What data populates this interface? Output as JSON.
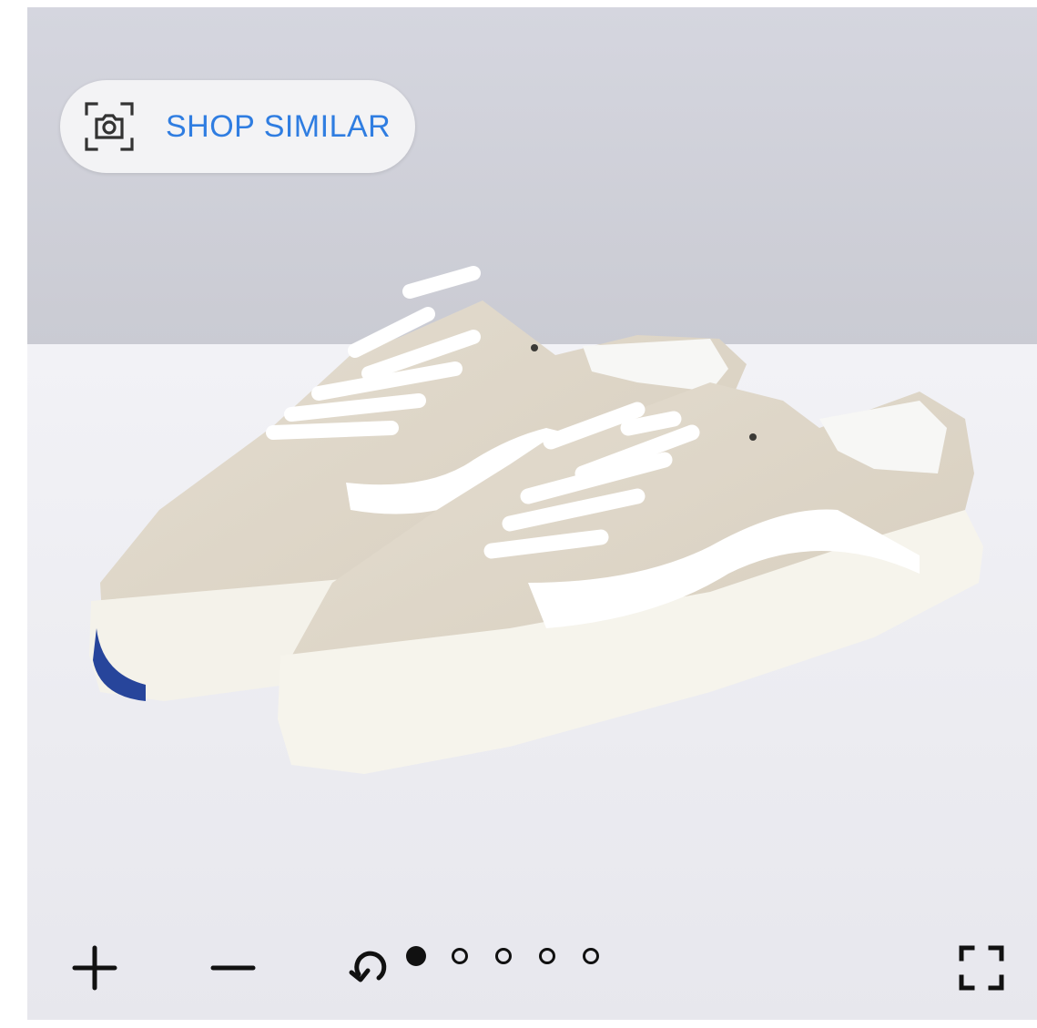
{
  "shop_similar": {
    "label": "SHOP SIMILAR",
    "icon": "camera-scan-icon",
    "color": "#2f7de1"
  },
  "toolbar": {
    "zoom_in_icon": "plus-icon",
    "zoom_out_icon": "minus-icon",
    "rotate_icon": "rotate-icon",
    "fullscreen_icon": "fullscreen-icon"
  },
  "carousel": {
    "total_images": 5,
    "active_index": 0
  }
}
